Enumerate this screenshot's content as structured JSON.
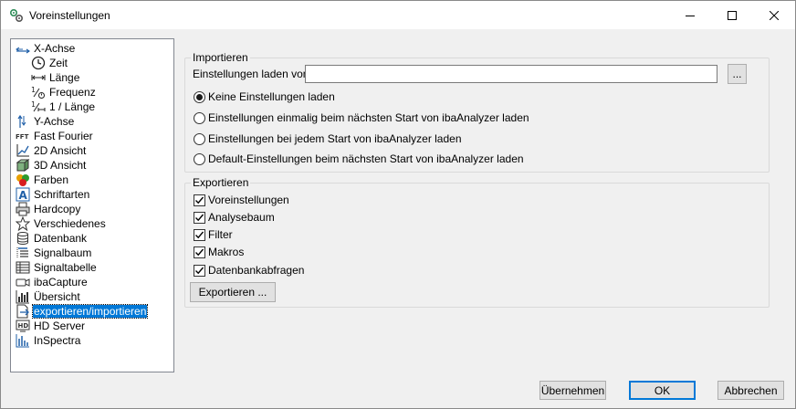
{
  "window": {
    "title": "Voreinstellungen"
  },
  "tree": {
    "items": [
      {
        "label": "X-Achse",
        "icon": "x-axis-icon"
      },
      {
        "label": "Zeit",
        "icon": "clock-icon"
      },
      {
        "label": "Länge",
        "icon": "length-icon"
      },
      {
        "label": "Frequenz",
        "icon": "frequency-icon"
      },
      {
        "label": "1 / Länge",
        "icon": "inverse-length-icon"
      },
      {
        "label": "Y-Achse",
        "icon": "y-axis-icon"
      },
      {
        "label": "Fast Fourier",
        "icon": "fft-icon"
      },
      {
        "label": "2D Ansicht",
        "icon": "chart-2d-icon"
      },
      {
        "label": "3D Ansicht",
        "icon": "cube-3d-icon"
      },
      {
        "label": "Farben",
        "icon": "colors-icon"
      },
      {
        "label": "Schriftarten",
        "icon": "font-icon"
      },
      {
        "label": "Hardcopy",
        "icon": "printer-icon"
      },
      {
        "label": "Verschiedenes",
        "icon": "star-icon"
      },
      {
        "label": "Datenbank",
        "icon": "database-icon"
      },
      {
        "label": "Signalbaum",
        "icon": "signal-tree-icon"
      },
      {
        "label": "Signaltabelle",
        "icon": "table-icon"
      },
      {
        "label": "ibaCapture",
        "icon": "camera-icon"
      },
      {
        "label": "Übersicht",
        "icon": "overview-icon"
      },
      {
        "label": "exportieren/importieren",
        "icon": "export-import-icon"
      },
      {
        "label": "HD Server",
        "icon": "hd-server-icon"
      },
      {
        "label": "InSpectra",
        "icon": "inspectra-icon"
      }
    ]
  },
  "import": {
    "legend": "Importieren",
    "load_label": "Einstellungen laden von:",
    "path_value": "",
    "browse_label": "...",
    "options": [
      {
        "label": "Keine Einstellungen laden",
        "selected": true
      },
      {
        "label": "Einstellungen einmalig beim nächsten Start von ibaAnalyzer laden",
        "selected": false
      },
      {
        "label": "Einstellungen bei jedem Start von ibaAnalyzer laden",
        "selected": false
      },
      {
        "label": "Default-Einstellungen beim nächsten Start von ibaAnalyzer laden",
        "selected": false
      }
    ]
  },
  "export": {
    "legend": "Exportieren",
    "options": [
      {
        "label": "Voreinstellungen",
        "checked": true
      },
      {
        "label": "Analysebaum",
        "checked": true
      },
      {
        "label": "Filter",
        "checked": true
      },
      {
        "label": "Makros",
        "checked": true
      },
      {
        "label": "Datenbankabfragen",
        "checked": true
      }
    ],
    "export_button": "Exportieren ..."
  },
  "buttons": {
    "apply": "Übernehmen",
    "ok": "OK",
    "cancel": "Abbrechen"
  },
  "colors": {
    "selection": "#0078d7",
    "accent_blue": "#1f5fa8"
  }
}
